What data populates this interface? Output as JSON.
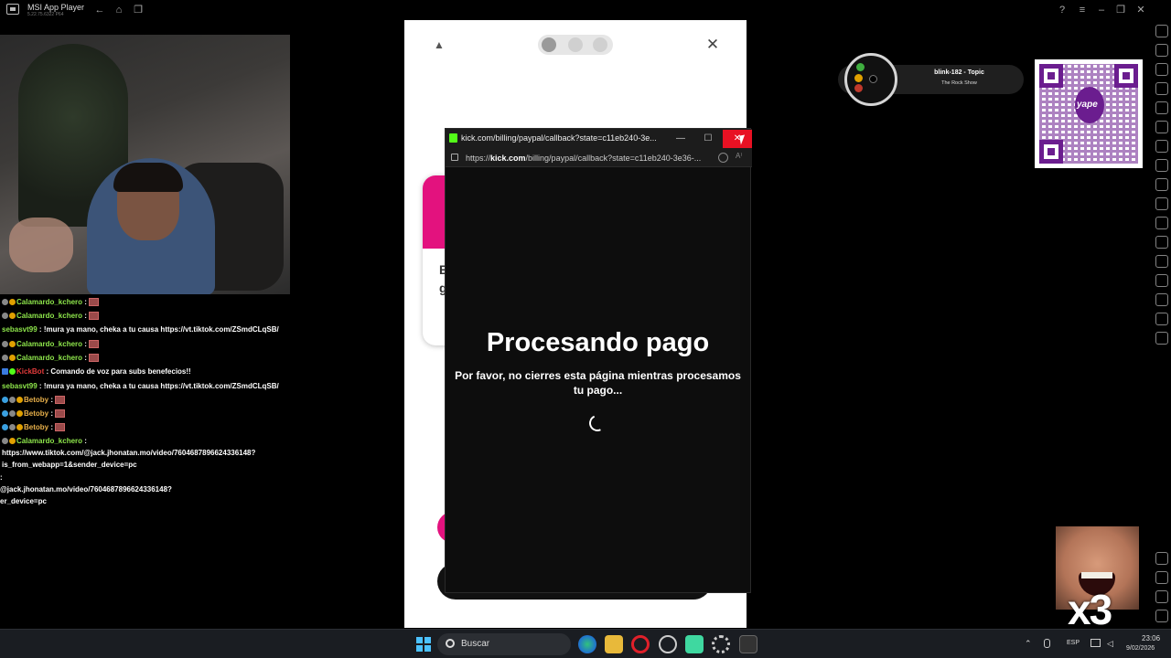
{
  "app": {
    "title": "MSI App Player",
    "version": "5.22.75.6322 P64"
  },
  "chat": [
    {
      "user": "Calamardo_kchero",
      "sep": " :",
      "text": "",
      "emote": true,
      "color": "green"
    },
    {
      "user": "Calamardo_kchero",
      "sep": " :",
      "text": "",
      "emote": true,
      "color": "green"
    },
    {
      "user": "sebasvt99",
      "sep": " :",
      "text": " !mura ya mano, cheka a tu causa https://vt.tiktok.com/ZSmdCLqSB/",
      "emote": false,
      "color": "green"
    },
    {
      "user": "Calamardo_kchero",
      "sep": " :",
      "text": "",
      "emote": true,
      "color": "green"
    },
    {
      "user": "Calamardo_kchero",
      "sep": " :",
      "text": "",
      "emote": true,
      "color": "green"
    },
    {
      "user": "KickBot",
      "sep": " :",
      "text": " Comando de voz para subs benefecios!!",
      "emote": false,
      "color": "red"
    },
    {
      "user": "sebasvt99",
      "sep": " :",
      "text": " !mura ya mano, cheka a tu causa https://vt.tiktok.com/ZSmdCLqSB/",
      "emote": false,
      "color": "green"
    },
    {
      "user": "Betoby",
      "sep": " :",
      "text": "",
      "emote": true,
      "color": "green"
    },
    {
      "user": "Betoby",
      "sep": " :",
      "text": "",
      "emote": true,
      "color": "green"
    },
    {
      "user": "Betoby",
      "sep": " :",
      "text": "",
      "emote": true,
      "color": "green"
    },
    {
      "user": "Calamardo_kchero",
      "sep": " :",
      "text": "",
      "emote": false,
      "color": "green"
    }
  ],
  "chat_wrapped": [
    "https://www.tiktok.com/@jack.jhonatan.mo/video/7604687896624336148?",
    "is_from_webapp=1&sender_device=pc",
    ":",
    "@jack.jhonatan.mo/video/7604687896624336148?",
    "er_device=pc"
  ],
  "popup": {
    "window_title": "kick.com/billing/paypal/callback?state=c11eb240-3e...",
    "url_prefix": "https://",
    "url_domain": "kick.com",
    "url_rest": "/billing/paypal/callback?state=c11eb240-3e36-...",
    "minimize": "—",
    "maximize": "☐",
    "close": "✕",
    "heading": "Procesando pago",
    "subtext": "Por favor, no cierres esta página mientras procesamos tu pago...",
    "reader_label": "A⁾"
  },
  "phone": {
    "close": "✕",
    "warn": "▲",
    "card_text": "E e g"
  },
  "music": {
    "title": "blink-182 - Topic",
    "subtitle": "The Rock Show"
  },
  "qr": {
    "logo_text": "yape"
  },
  "meme": {
    "label": "x3"
  },
  "taskbar": {
    "search_placeholder": "Buscar",
    "language": "ESP",
    "time": "23:06",
    "date": "9/02/2026"
  },
  "colors": {
    "kick_green": "#53fc18",
    "phone_accent": "#e3127e",
    "close_red": "#e81123",
    "chat_green": "#8ee64b",
    "bot_red": "#e23b3b",
    "yape_purple": "#6b1d8f"
  }
}
